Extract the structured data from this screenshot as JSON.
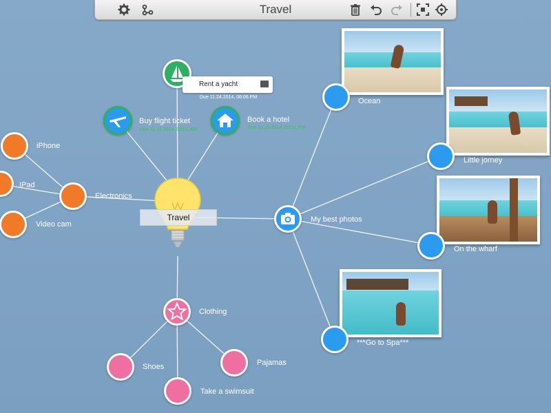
{
  "toolbar": {
    "title": "Travel",
    "icons": [
      "gear-icon",
      "share-icon",
      "trash-icon",
      "undo-icon",
      "redo-icon",
      "fit-screen-icon",
      "focus-icon"
    ]
  },
  "central": {
    "label": "Travel"
  },
  "tasks": {
    "rent": {
      "label": "Rent a yacht",
      "due": "Due  11.24.2014, 06:06 PM"
    },
    "flight": {
      "label": "Buy flight ticket",
      "due": "Due  11.23.2014, 02:01 AM"
    },
    "hotel": {
      "label": "Book a hotel",
      "due": "Due  11.23.2014, 05:01 PM"
    }
  },
  "electronics": {
    "label": "Electronics",
    "children": [
      "iPhone",
      "IPad",
      "Video cam"
    ]
  },
  "clothing": {
    "label": "Clothing",
    "children": [
      "Shoes",
      "Take a swimsuit",
      "Pajamas"
    ]
  },
  "photos": {
    "label": "My best photos",
    "children": [
      "Ocean",
      "Little jorney",
      "On the wharf",
      "***Go to Spa***"
    ]
  },
  "colors": {
    "orange": "#f07a28",
    "pink": "#ef6fa0",
    "blue": "#2b9bef",
    "green": "#2eb063",
    "background": "#7fa3c4"
  }
}
